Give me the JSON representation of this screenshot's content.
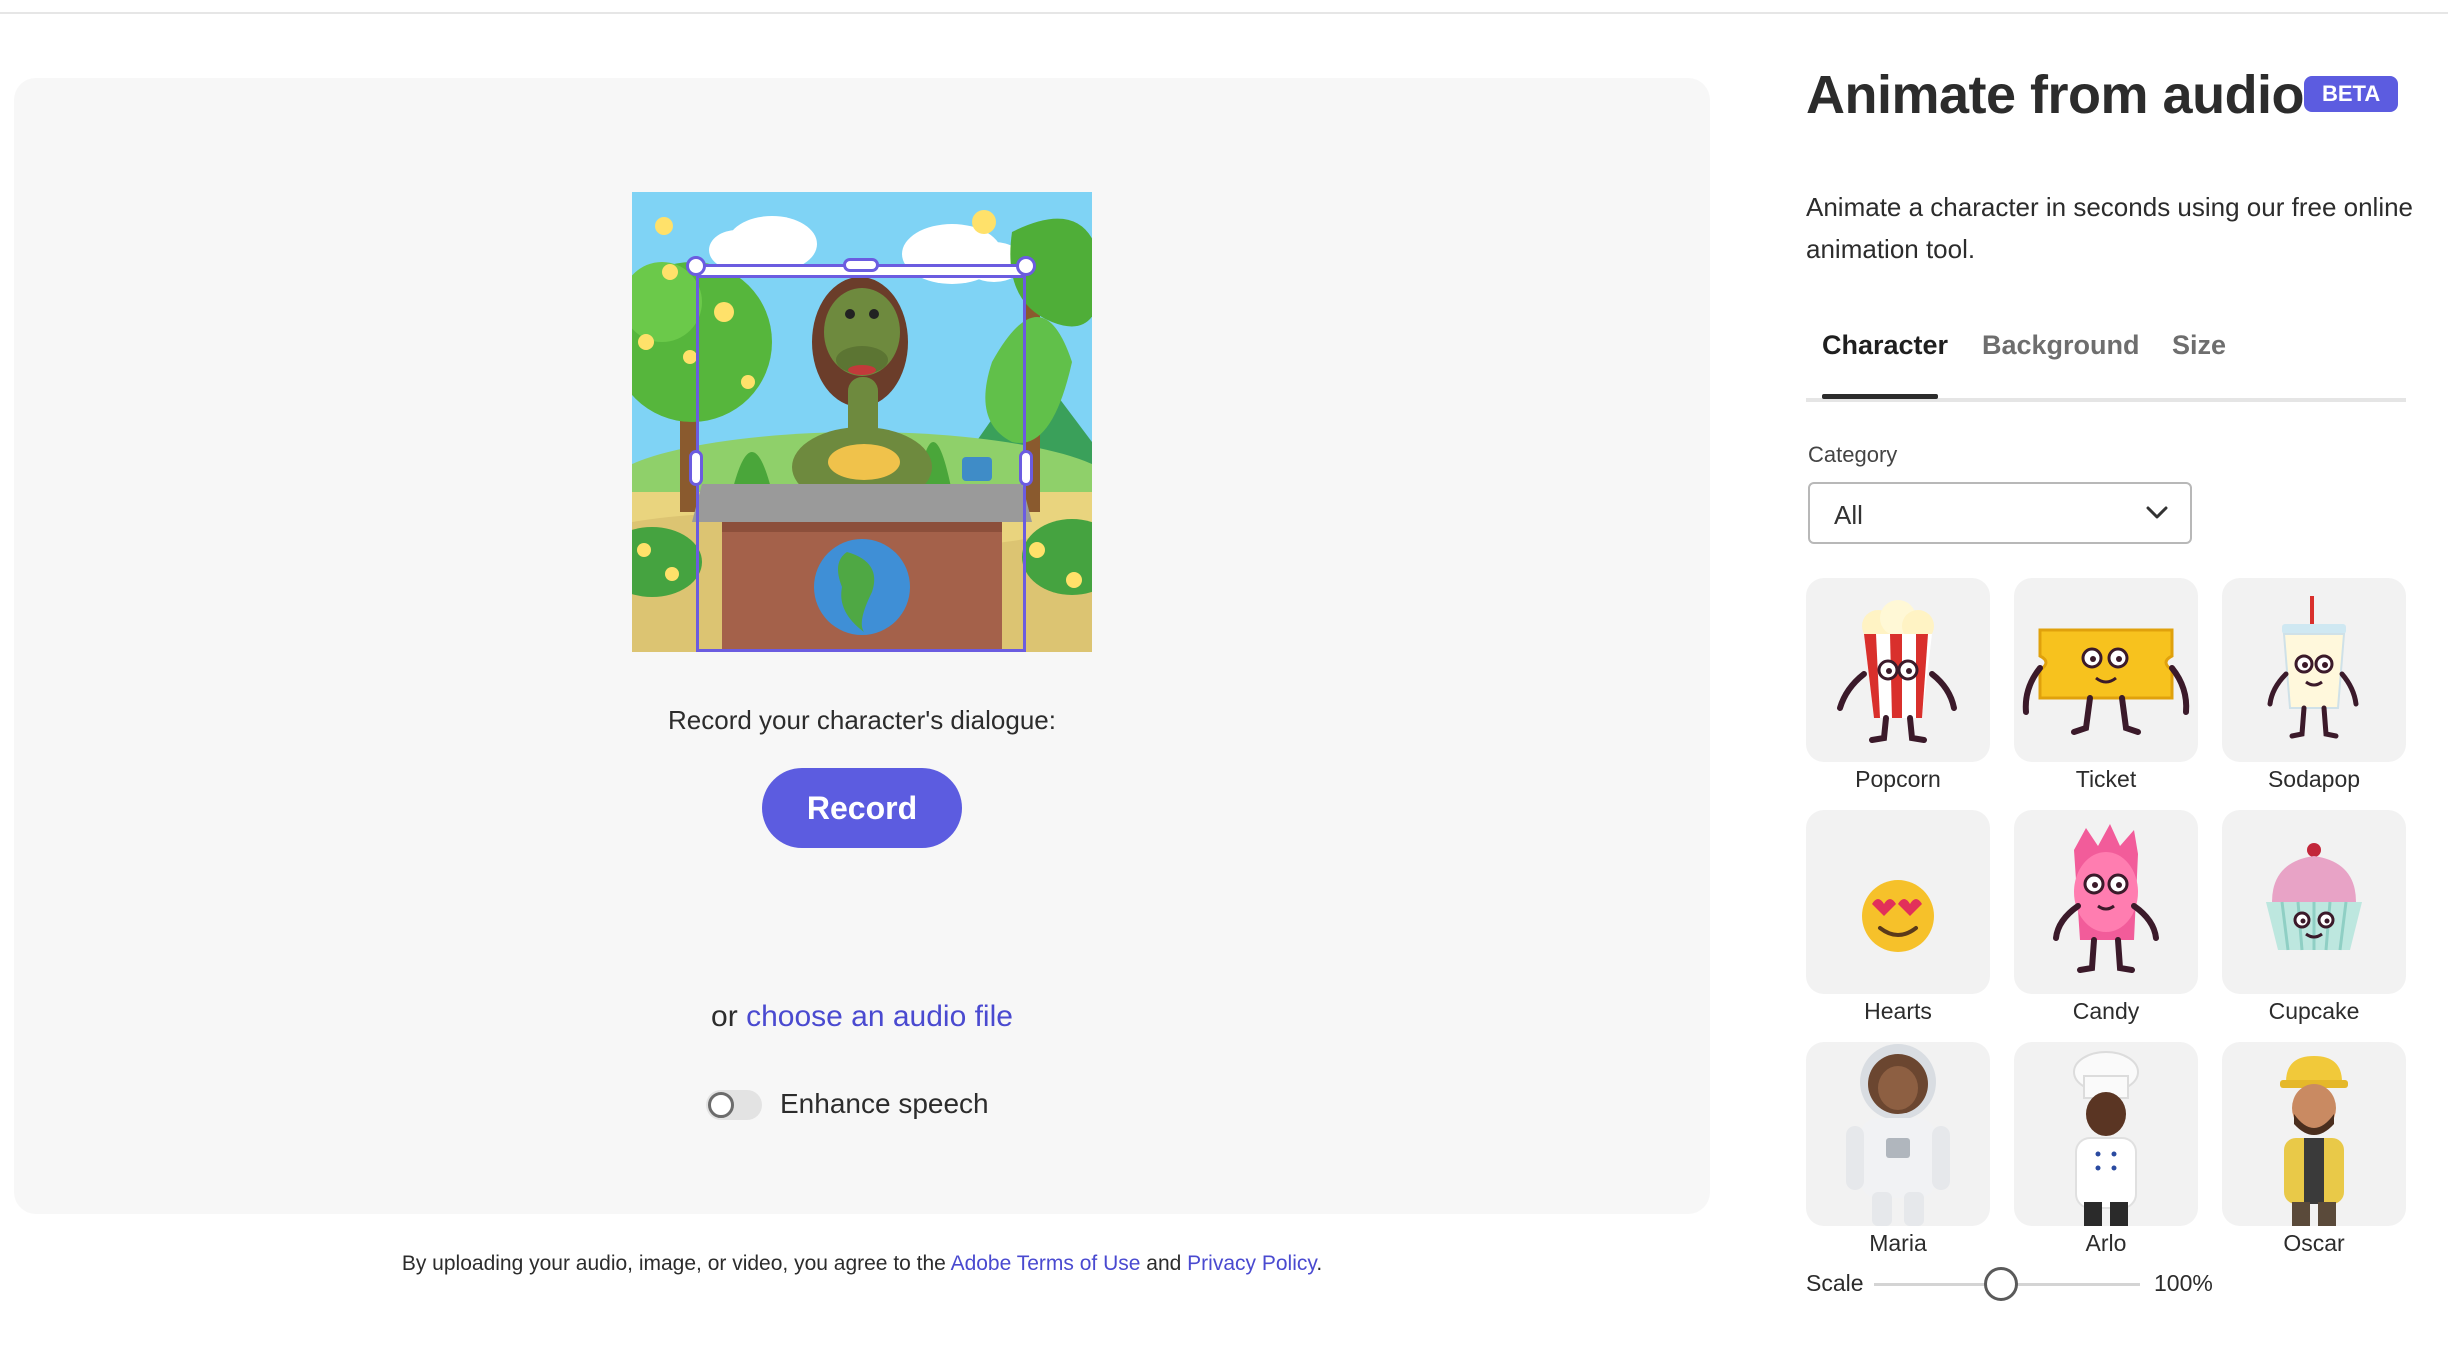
{
  "header": {
    "title": "Animate from audio",
    "badge": "BETA",
    "description": "Animate a character in seconds using our free online animation tool."
  },
  "tabs": [
    {
      "label": "Character",
      "active": true
    },
    {
      "label": "Background",
      "active": false
    },
    {
      "label": "Size",
      "active": false
    }
  ],
  "category": {
    "label": "Category",
    "selected": "All"
  },
  "characters": [
    {
      "name": "Popcorn",
      "icon": "popcorn-character"
    },
    {
      "name": "Ticket",
      "icon": "ticket-character"
    },
    {
      "name": "Sodapop",
      "icon": "sodapop-character"
    },
    {
      "name": "Hearts",
      "icon": "heart-eyes-emoji-character"
    },
    {
      "name": "Candy",
      "icon": "candy-character"
    },
    {
      "name": "Cupcake",
      "icon": "cupcake-character"
    },
    {
      "name": "Maria",
      "icon": "astronaut-character"
    },
    {
      "name": "Arlo",
      "icon": "chef-character"
    },
    {
      "name": "Oscar",
      "icon": "builder-character"
    }
  ],
  "scale": {
    "label": "Scale",
    "value_text": "100%",
    "level": 0.5
  },
  "workspace": {
    "record_prompt": "Record your character's dialogue:",
    "record_label": "Record",
    "or_text": "or",
    "choose_file_link": "choose an audio file",
    "enhance_label": "Enhance speech",
    "enhance_enabled": false
  },
  "legal": {
    "prefix": "By uploading your audio, image, or video, you agree to the",
    "terms_link": "Adobe Terms of Use",
    "and": "and",
    "privacy_link": "Privacy Policy",
    "suffix": "."
  },
  "colors": {
    "accent": "#5c5ce0",
    "link": "#4a4ad0",
    "selection": "#6b5ce0"
  }
}
